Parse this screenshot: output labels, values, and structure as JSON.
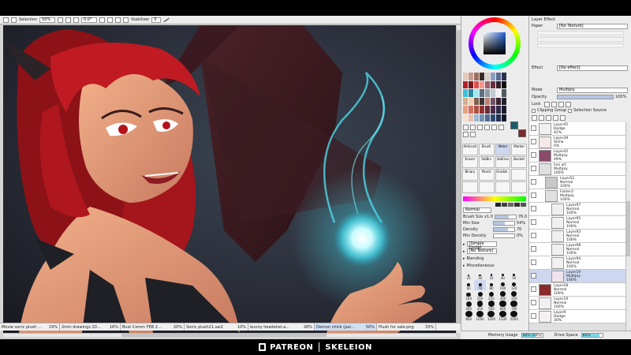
{
  "toolbar": {
    "selection_label": "Selection",
    "zoom": "50%",
    "rotation": "0.0°",
    "stabilizer_label": "Stabilizer",
    "stabilizer_value": "5"
  },
  "tool_panel": {
    "tools": [
      "Airbrush",
      "Brush",
      "Water",
      "Marker",
      "Eraser",
      "SelBrs",
      "SelEras",
      "Bucket",
      "Binary",
      "Pencil",
      "Gradat.."
    ],
    "mode_value": "Normal",
    "brush_size_label": "Brush Size",
    "brush_size_mult": "x1.0",
    "brush_size_value": "76.0",
    "min_size_label": "Min Size",
    "min_size_value": "54%",
    "density_label": "Density",
    "density_value": "70",
    "min_density_label": "Min Density",
    "min_density_value": "0%",
    "shape_value": "[Simple Circle]",
    "texture_value": "[No Texture]",
    "blending_label": "Blending",
    "misc_label": "Miscellaneous",
    "size_presets": [
      "25",
      "30",
      "35",
      "40",
      "50",
      "60",
      "70",
      "80",
      "100",
      "120",
      "160",
      "200",
      "250",
      "300",
      "350",
      "400",
      "450",
      "500",
      "600",
      "700",
      "800",
      "1000",
      "1200",
      "1500",
      "2000"
    ],
    "brush_size_pct": 0.65,
    "min_size_pct": 0.54,
    "density_pct": 0.7,
    "min_density_pct": 0.0
  },
  "layer_panel": {
    "title": "Layer Effect",
    "paper_label": "Paper",
    "paper_value": "[No Texture]",
    "effect_label": "Effect",
    "effect_value": "[No effect]",
    "mode_label": "Mode",
    "mode_value": "Multiply",
    "opacity_label": "Opacity",
    "opacity_value": "100%",
    "lock_label": "Lock",
    "clipping_label": "Clipping Group",
    "selection_source_label": "Selection Source",
    "layers": [
      {
        "name": "Layer45",
        "mode": "Dodge",
        "opacity": "42%",
        "sel": false,
        "indent": 0
      },
      {
        "name": "Layer39",
        "mode": "Shine",
        "opacity": "0%",
        "sel": false,
        "indent": 0
      },
      {
        "name": "Layer42",
        "mode": "Multiply",
        "opacity": "49%",
        "sel": false,
        "indent": 0
      },
      {
        "name": "line art",
        "mode": "Multiply",
        "opacity": "100%",
        "sel": false,
        "indent": 0,
        "folder": true
      },
      {
        "name": "Layer52",
        "mode": "Normal",
        "opacity": "100%",
        "sel": false,
        "indent": 1
      },
      {
        "name": "Folder3",
        "mode": "Multiply",
        "opacity": "100%",
        "sel": false,
        "indent": 1,
        "folder": true
      },
      {
        "name": "Layer97",
        "mode": "Normal",
        "opacity": "100%",
        "sel": false,
        "indent": 2
      },
      {
        "name": "Layer95",
        "mode": "Normal",
        "opacity": "100%",
        "sel": false,
        "indent": 2
      },
      {
        "name": "Layer93",
        "mode": "Normal",
        "opacity": "100%",
        "sel": false,
        "indent": 2
      },
      {
        "name": "Layer98",
        "mode": "Normal",
        "opacity": "100%",
        "sel": false,
        "indent": 2
      },
      {
        "name": "Layer94",
        "mode": "Normal",
        "opacity": "100%",
        "sel": false,
        "indent": 2
      },
      {
        "name": "Layer19",
        "mode": "Multiply",
        "opacity": "100%",
        "sel": true,
        "indent": 2
      },
      {
        "name": "Layer28",
        "mode": "Normal",
        "opacity": "100%",
        "sel": false,
        "indent": 0
      },
      {
        "name": "Layer19",
        "mode": "Normal",
        "opacity": "100%",
        "sel": false,
        "indent": 0
      },
      {
        "name": "Layer9",
        "mode": "Dodge",
        "opacity": "30%",
        "sel": false,
        "indent": 0
      }
    ]
  },
  "taskbar": [
    {
      "name": "Movie sonic plush ...",
      "zoom": "19%"
    },
    {
      "name": "2min drawings 20...",
      "zoom": "16%"
    },
    {
      "name": "Bust Comm FEB 2...",
      "zoom": "20%"
    },
    {
      "name": "Sonic plush21.sai2",
      "zoom": "10%"
    },
    {
      "name": "bunny headshot.a...",
      "zoom": "28%"
    },
    {
      "name": "Demon chick (pai...",
      "zoom": "50%"
    },
    {
      "name": "Plush for sale.png",
      "zoom": "33%"
    }
  ],
  "status": {
    "memory_label": "Memory Usage",
    "memory_value": "68% (69%)",
    "memory_pct": 0.68,
    "drive_label": "Drive Space",
    "drive_value": "84%",
    "drive_pct": 0.84
  },
  "credit": {
    "left": "PATREON",
    "right": "SKELEION"
  },
  "colors": {
    "bg": "#000000",
    "panel": "#ececec",
    "selected_layer": "#cdd8f0",
    "orb": "#7fe8f2",
    "hair": "#a5161c",
    "accent": "#7fd6e6"
  }
}
